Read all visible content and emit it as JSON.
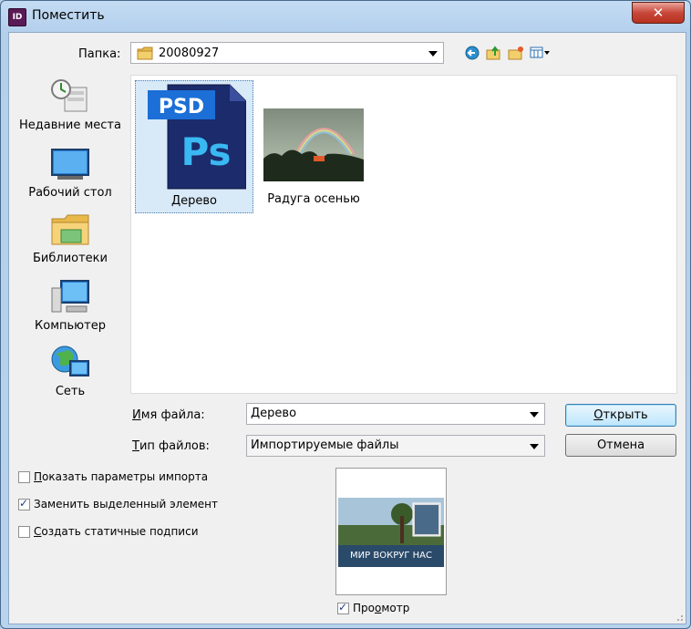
{
  "window": {
    "title": "Поместить",
    "app_icon": "indesign-icon"
  },
  "folder": {
    "label": "Папка:",
    "value": "20080927"
  },
  "places": [
    {
      "label": "Недавние места",
      "icon": "recent-places-icon"
    },
    {
      "label": "Рабочий стол",
      "icon": "desktop-icon"
    },
    {
      "label": "Библиотеки",
      "icon": "libraries-icon"
    },
    {
      "label": "Компьютер",
      "icon": "computer-icon"
    },
    {
      "label": "Сеть",
      "icon": "network-icon"
    }
  ],
  "files": [
    {
      "name": "Дерево",
      "badge": "PSD",
      "logo": "Ps",
      "selected": true
    },
    {
      "name": "Радуга осенью",
      "selected": false
    }
  ],
  "filename": {
    "label": "Имя файла:",
    "value": "Дерево"
  },
  "filetype": {
    "label": "Тип файлов:",
    "value": "Импортируемые файлы"
  },
  "buttons": {
    "open": "Открыть",
    "cancel": "Отмена"
  },
  "options": [
    {
      "label": "Показать параметры импорта",
      "checked": false
    },
    {
      "label": "Заменить выделенный элемент",
      "checked": true
    },
    {
      "label": "Создать статичные подписи",
      "checked": false
    }
  ],
  "preview": {
    "caption": "МИР ВОКРУГ НАС",
    "label": "Просмотр",
    "checked": true
  },
  "colors": {
    "accent": "#3c7fb1",
    "selection": "#d8e9f8",
    "close": "#c8473a"
  }
}
